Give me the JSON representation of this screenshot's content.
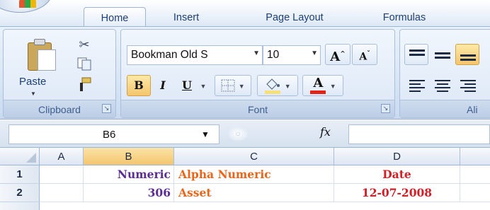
{
  "ribbon": {
    "tabs": [
      {
        "label": "Home",
        "active": true
      },
      {
        "label": "Insert",
        "active": false
      },
      {
        "label": "Page Layout",
        "active": false
      },
      {
        "label": "Formulas",
        "active": false
      }
    ],
    "clipboard": {
      "paste_label": "Paste",
      "group_label": "Clipboard",
      "icons": [
        "paste-icon",
        "cut-icon",
        "copy-icon",
        "format-painter-icon"
      ]
    },
    "font": {
      "group_label": "Font",
      "font_name": "Bookman Old S",
      "font_size": "10",
      "grow_font": "A",
      "shrink_font": "A",
      "bold": "B",
      "italic": "I",
      "underline": "U",
      "font_color_glyph": "A",
      "fill_color": "#f6e07a",
      "font_color": "#e2231a"
    },
    "alignment": {
      "group_label": "Ali"
    }
  },
  "formula_bar": {
    "name_box": "B6",
    "fx_label": "fx",
    "formula": ""
  },
  "sheet": {
    "columns": [
      "A",
      "B",
      "C",
      "D"
    ],
    "selected_column": "B",
    "rows": [
      {
        "number": "1",
        "cells": {
          "A": "",
          "B": "Numeric",
          "C": "Alpha Numeric",
          "D": "Date"
        }
      },
      {
        "number": "2",
        "cells": {
          "A": "",
          "B": "306",
          "C": "Asset",
          "D": "12-07-2008"
        }
      }
    ],
    "colors": {
      "numeric": "#5b2f91",
      "alpha_numeric": "#e8661c",
      "date": "#d11f26"
    }
  }
}
